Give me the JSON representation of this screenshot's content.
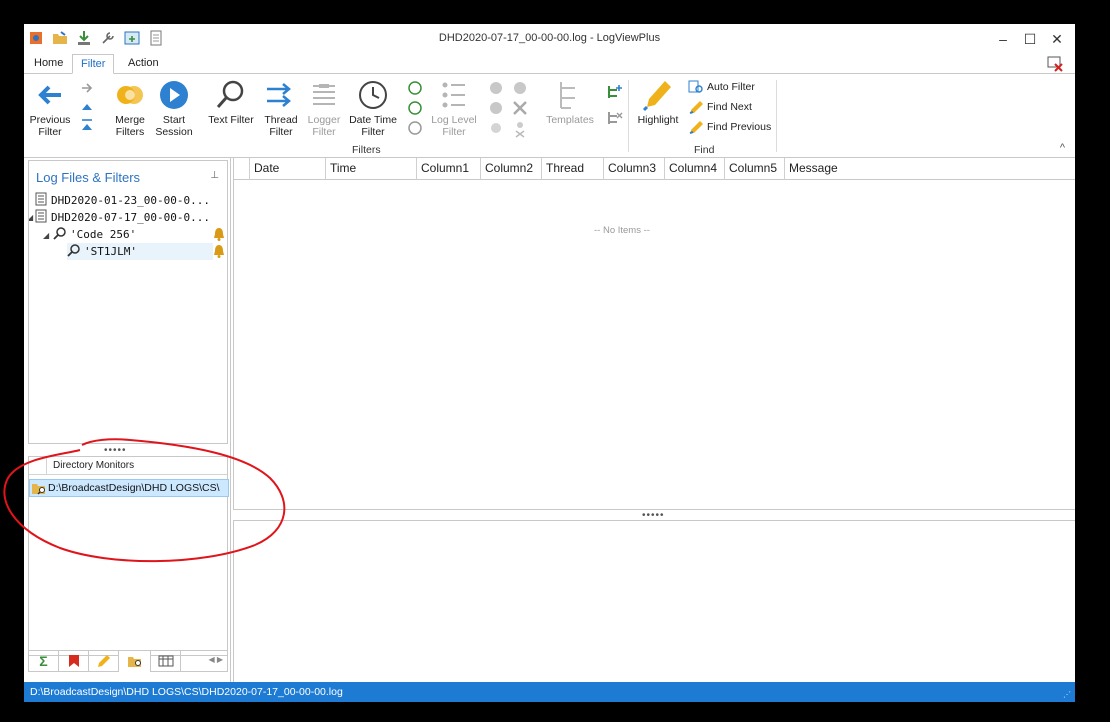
{
  "window": {
    "title": "DHD2020-07-17_00-00-00.log - LogViewPlus"
  },
  "window_controls": {
    "minimize": "–",
    "maximize": "☐",
    "close": "✕"
  },
  "ribbon_tabs": [
    {
      "label": "Home"
    },
    {
      "label": "Filter"
    },
    {
      "label": "Action"
    }
  ],
  "ribbon": {
    "previous_filter": "Previous\nFilter",
    "merge_filters": "Merge\nFilters",
    "start_session": "Start\nSession",
    "text_filter": "Text Filter",
    "thread_filter": "Thread\nFilter",
    "logger_filter": "Logger\nFilter",
    "date_time_filter": "Date Time\nFilter",
    "log_level_filter": "Log Level\nFilter",
    "templates": "Templates",
    "highlight": "Highlight",
    "auto_filter": "Auto Filter",
    "find_next": "Find Next",
    "find_previous": "Find Previous",
    "group_filters": "Filters",
    "group_find": "Find",
    "collapse": "^"
  },
  "left_panel": {
    "title": "Log Files & Filters",
    "pin": "⊥",
    "tree": [
      {
        "label": "DHD2020-01-23_00-00-0..."
      },
      {
        "label": "DHD2020-07-17_00-00-0..."
      },
      {
        "label": "'Code 256'"
      },
      {
        "label": "'ST1JLM'"
      }
    ],
    "splitter": "•••••",
    "directory_monitors": {
      "title": "Directory Monitors",
      "rows": [
        {
          "path": "D:\\BroadcastDesign\\DHD LOGS\\CS\\"
        }
      ]
    },
    "bottom_tabs": [
      {
        "icon": "sigma-icon",
        "glyph": "Σ"
      },
      {
        "icon": "bookmark-icon",
        "glyph": ""
      },
      {
        "icon": "highlighter-icon",
        "glyph": ""
      },
      {
        "icon": "folder-search-icon",
        "glyph": ""
      },
      {
        "icon": "columns-icon",
        "glyph": ""
      }
    ],
    "tab_arrows": "◀ ▶"
  },
  "grid": {
    "columns": [
      "Date",
      "Time",
      "Column1",
      "Column2",
      "Thread",
      "Column3",
      "Column4",
      "Column5",
      "Message"
    ],
    "empty_text": "-- No Items --",
    "splitter": "•••••"
  },
  "status_bar": {
    "path": "D:\\BroadcastDesign\\DHD LOGS\\CS\\DHD2020-07-17_00-00-00.log",
    "grip": "⋰"
  },
  "colors": {
    "accent": "#1e7bd4",
    "title_blue": "#2e73c2",
    "annotation": "#e0141b",
    "selection": "#cce8ff"
  }
}
